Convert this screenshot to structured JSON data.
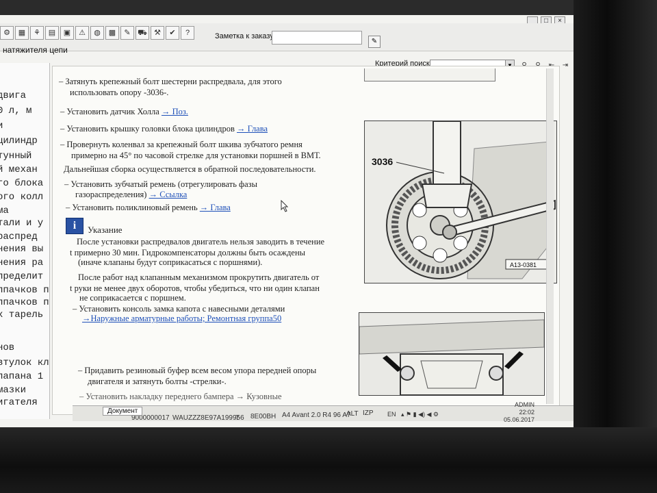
{
  "window": {
    "note_label": "Заметка к заказу:",
    "breadcrumb": "натяжителя цепи",
    "search_label": "Критерий поиска:",
    "admin_label": "ADMIN"
  },
  "left_pane": {
    "lines": [
      "двига",
      "0 л, м",
      "и",
      "цилиндр",
      "тунный",
      "й механ",
      "го блока",
      "ого колл",
      "ма",
      "тали и у",
      "распред",
      "нения вы",
      "нения ра",
      "пределит",
      "лпачков п",
      "лпачков п",
      "х тарель",
      "",
      "нов",
      "втулок кл",
      "лапана 1 сл",
      "мазки",
      "игателя"
    ]
  },
  "doc": {
    "item1_a": "Затянуть крепежный болт шестерни распредвала, для этого",
    "item1_b": "использовать опору -3036-.",
    "item2": "Установить датчик Холла",
    "item2_link": "→ Поз.",
    "item3": "Установить крышку головки блока цилиндров",
    "item3_link": "→ Глава",
    "item4_a": "Провернуть коленвал за крепежный болт шкива зубчатого ремня",
    "item4_b": "примерно на 45° по часовой стрелке для установки поршней в ВМТ.",
    "para1": "Дальнейшая сборка осуществляется в обратной последовательности.",
    "item5_a": "Установить зубчатый ремень (отрегулировать фазы",
    "item5_b": "газораспределения)",
    "item5_link": "→ Ссылка",
    "item6": "Установить поликлиновый ремень",
    "item6_link": "→ Глава",
    "note_title": "Указание",
    "note1_a": "После установки распредвалов двигатель нельзя заводить в течение",
    "note1_b": "примерно 30 мин. Гидрокомпенсаторы должны быть осаждены",
    "note1_c": "(иначе клапаны будут соприкасаться с поршнями).",
    "note2_a": "После работ над клапанным механизмом прокрутить двигатель от",
    "note2_b": "руки не менее двух оборотов, чтобы убедиться, что ни один клапан",
    "note2_c": "не соприкасается с поршнем.",
    "item7_a": "Установить консоль замка капота с навесными деталями",
    "item7_link": "→Наружные арматурные работы; Ремонтная группа50",
    "item8_a": "Придавить резиновый буфер всем весом упора передней опоры",
    "item8_b": "двигателя и затянуть болты -стрелки-.",
    "item9": "Установить накладку переднего бампера → Кузовные",
    "fig1_callout": "3036",
    "fig1_id": "A13-0381"
  },
  "statusbar": {
    "doc_tab": "Документ",
    "order": "9000000017",
    "vin": "WAUZZZ8E97A199956",
    "field3": "7",
    "code": "8E00BH",
    "model": "A4 Avant 2.0 R4 96 A7",
    "field6": "ALT",
    "field7": "IZP",
    "lang": "EN",
    "time": "22:02",
    "date": "05.06.2017"
  },
  "colors": {
    "link": "#1d4fb8",
    "info_icon_bg": "#2a52a3"
  },
  "icons": [
    "wrench-icon",
    "engine-icon",
    "book-icon",
    "alert-icon",
    "globe-icon",
    "car-icon",
    "printer-icon",
    "help-icon"
  ]
}
